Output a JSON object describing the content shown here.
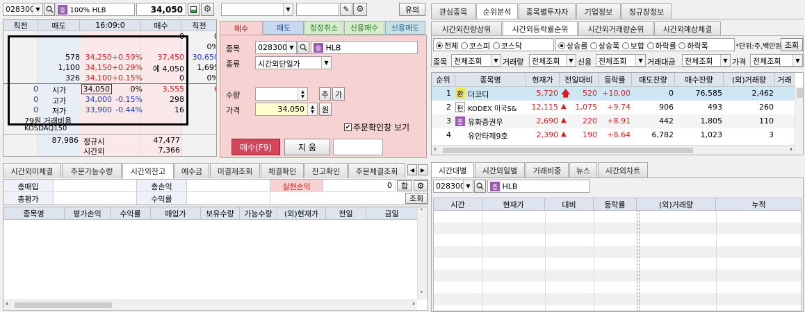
{
  "top_left": {
    "code": "028300",
    "pct": "100%",
    "name": "HLB",
    "price": "34,050"
  },
  "top_mid": {
    "btn_right": "유의"
  },
  "orderbook": {
    "headers": [
      "직전",
      "매도",
      "16:09:0",
      "매수",
      "직전"
    ],
    "rows": [
      {
        "c1": "",
        "sell": "",
        "price": "",
        "chg": "",
        "buy": "0",
        "c5": "0"
      },
      {
        "c1": "",
        "sell": "",
        "price": "",
        "chg": "",
        "buy": "",
        "c5": "0%"
      },
      {
        "c1": "",
        "sell": "578",
        "price": "34,250",
        "chg": "+0.59%",
        "buy": "37,450",
        "c5": "30,650"
      },
      {
        "c1": "",
        "sell": "1,100",
        "price": "34,150",
        "chg": "+0.29%",
        "buy": "예 4,050",
        "c5": "1,695"
      },
      {
        "c1": "",
        "sell": "326",
        "price": "34,100",
        "chg": "+0.15%",
        "buy": "0",
        "c5": "0%"
      },
      {
        "c1": "0",
        "sell": "시가",
        "price": "34,050",
        "chg": "0%",
        "buy": "3,555",
        "c5": "6"
      },
      {
        "c1": "0",
        "sell": "고가",
        "price": "34,000",
        "chg": "-0.15%",
        "buy": "298",
        "c5": ""
      },
      {
        "c1": "0",
        "sell": "저가",
        "price": "33,900",
        "chg": "-0.44%",
        "buy": "16",
        "c5": ""
      }
    ],
    "cost_label": "79원 거래비용",
    "market": "KOSDAQ150",
    "total_sell": "87,986",
    "reg_label": "정규시",
    "total_buy": "47,477",
    "ext_label": "시간외",
    "ext_val": "7,366"
  },
  "order": {
    "tabs": [
      "매수",
      "매도",
      "정정취소",
      "신용매수",
      "신용매도"
    ],
    "code_label": "종목",
    "code": "028300",
    "name": "HLB",
    "type_label": "종류",
    "type_value": "시간외단일가",
    "qty_label": "수량",
    "qty_btn1": "주",
    "qty_btn2": "가",
    "price_label": "가격",
    "price_value": "34,050",
    "price_unit": "원",
    "confirm_label": "주문확인창 보기",
    "buy_btn": "매수(F9)",
    "reset_btn": "지  움"
  },
  "right_top": {
    "tabs": [
      "관심종목",
      "순위분석",
      "종목별투자자",
      "기업정보",
      "정규장정보"
    ],
    "subtabs": [
      "시간외잔량상위",
      "시간외등락률순위",
      "시간외거래량순위",
      "시간외예상체결"
    ],
    "radios1": [
      "전체",
      "코스피",
      "코스닥"
    ],
    "radios2": [
      "상승률",
      "상승폭",
      "보합",
      "하락률",
      "하락폭"
    ],
    "unit_label": "*단위:주,백만원",
    "query_btn": "조회",
    "filters": [
      {
        "label": "종목",
        "value": "전체조회"
      },
      {
        "label": "거래량",
        "value": "전체조회"
      },
      {
        "label": "신용",
        "value": "전체조회"
      },
      {
        "label": "거래대금",
        "value": "전체조회"
      },
      {
        "label": "가격",
        "value": "전체조회"
      }
    ],
    "columns": [
      "순위",
      "종목명",
      "현재가",
      "전일대비",
      "등락률",
      "매도잔량",
      "매수잔량",
      "(외)거래량",
      "거래"
    ],
    "rows": [
      {
        "rank": "1",
        "tag": "환",
        "name": "더코디",
        "price": "5,720",
        "diff": "520",
        "rate": "+10.00",
        "sell": "0",
        "buy": "76,585",
        "vol": "2,462"
      },
      {
        "rank": "2",
        "tag": "펀",
        "name": "KODEX 미국S&",
        "price": "12,115",
        "diff": "1,075",
        "rate": "+9.74",
        "sell": "906",
        "buy": "493",
        "vol": "260"
      },
      {
        "rank": "3",
        "tag": "증",
        "name": "유화증권우",
        "price": "2,690",
        "diff": "220",
        "rate": "+8.91",
        "sell": "442",
        "buy": "1,805",
        "vol": "110"
      },
      {
        "rank": "4",
        "tag": "",
        "name": "유안타제9호",
        "price": "2,390",
        "diff": "190",
        "rate": "+8.64",
        "sell": "6,782",
        "buy": "1,023",
        "vol": "3"
      }
    ]
  },
  "bottom_left": {
    "tabs": [
      "시간외미체결",
      "주문가능수량",
      "시간외잔고",
      "예수금",
      "미결제조회",
      "체결확인",
      "잔고확인",
      "주문체결조회"
    ],
    "label1": "총매입",
    "label2": "총손익",
    "label3": "실현손익",
    "realized": "0",
    "sum_btn": "합",
    "label4": "총평가",
    "label5": "수익률",
    "query_btn": "조회",
    "columns": [
      "종목명",
      "평가손익",
      "수익률",
      "매입가",
      "보유수량",
      "가능수량",
      "(외)현재가",
      "전일",
      "금일"
    ]
  },
  "bottom_right": {
    "tabs": [
      "시간대별",
      "시간외일별",
      "거래비중",
      "뉴스",
      "시간외차트"
    ],
    "code": "028300",
    "name": "HLB",
    "columns": [
      "시간",
      "현재가",
      "대비",
      "등락률",
      "(외)거래량",
      "누적"
    ]
  },
  "colors": {
    "up": "#d81c1c",
    "down": "#1a3cc8",
    "buy_panel": "#f6d2d2"
  }
}
